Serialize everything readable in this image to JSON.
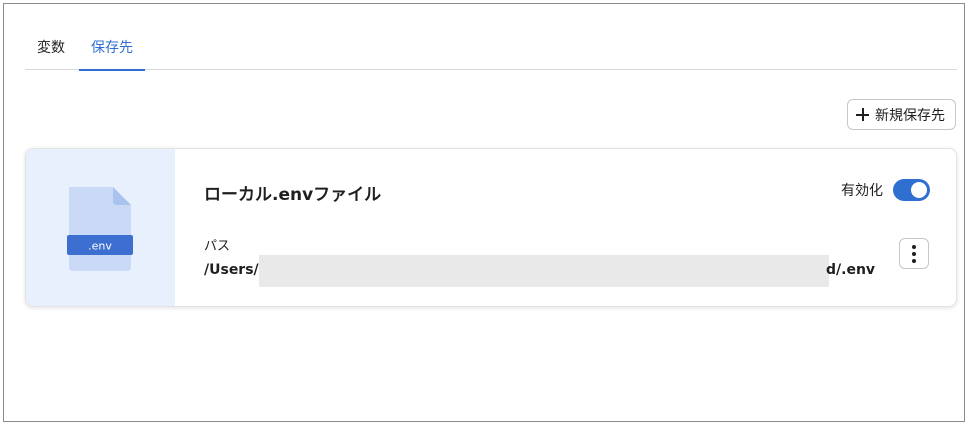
{
  "tabs": [
    {
      "label": "変数",
      "active": false
    },
    {
      "label": "保存先",
      "active": true
    }
  ],
  "toolbar": {
    "new_button_label": "新規保存先",
    "new_button_icon": "plus-icon"
  },
  "card": {
    "title": "ローカル.envファイル",
    "file_icon_label": ".env",
    "enable_label": "有効化",
    "enabled": true,
    "path_label": "パス",
    "path_prefix": "/Users/",
    "path_suffix": "d/.env",
    "more_icon": "vertical-ellipsis-icon"
  },
  "colors": {
    "accent": "#2f6fd2",
    "icon_pane_bg": "#e8f0fd",
    "file_body": "#c9d9f6",
    "file_badge": "#3c6fd0"
  }
}
